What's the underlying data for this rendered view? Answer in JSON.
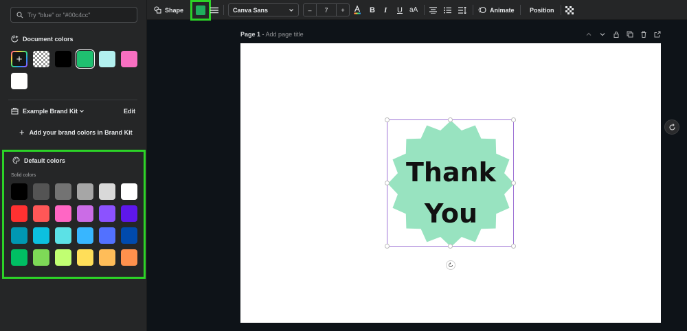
{
  "sidebar": {
    "search_placeholder": "Try \"blue\" or \"#00c4cc\"",
    "document_colors": {
      "title": "Document colors",
      "add_label": "+",
      "swatches": [
        "#000000",
        "#1fc070",
        "#b2f0ef",
        "#f86fc1",
        "#ffffff"
      ]
    },
    "brand_kit": {
      "title": "Example Brand Kit",
      "edit": "Edit",
      "add_label": "Add your brand colors in Brand Kit"
    },
    "default_colors": {
      "title": "Default colors",
      "solid_label": "Solid colors",
      "rows": [
        [
          "#000000",
          "#545454",
          "#737373",
          "#a6a6a6",
          "#d9d9d9",
          "#ffffff"
        ],
        [
          "#ff3131",
          "#ff5757",
          "#ff66c4",
          "#cb6ce6",
          "#8c52ff",
          "#5e17eb"
        ],
        [
          "#0097b2",
          "#0cc0df",
          "#5ce1e6",
          "#38b6ff",
          "#5271ff",
          "#004aad"
        ],
        [
          "#00bf63",
          "#7ed957",
          "#c1ff72",
          "#ffde59",
          "#ffbd59",
          "#ff914d"
        ]
      ]
    }
  },
  "toolbar": {
    "shape_label": "Shape",
    "current_color": "#1fae5c",
    "font": "Canva Sans",
    "font_size": "7",
    "minus": "–",
    "plus": "+",
    "bold": "B",
    "italic": "I",
    "underline": "U",
    "case": "aA",
    "animate": "Animate",
    "position": "Position"
  },
  "page": {
    "label": "Page 1",
    "title_placeholder": "Add page title",
    "shape_text_line1": "Thank",
    "shape_text_line2": "You",
    "shape_color": "#98e3c0"
  }
}
